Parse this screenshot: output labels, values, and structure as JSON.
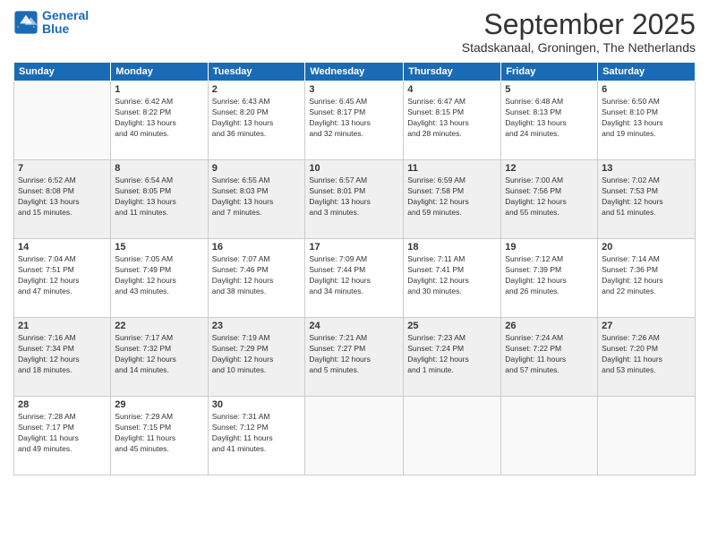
{
  "header": {
    "logo_line1": "General",
    "logo_line2": "Blue",
    "month": "September 2025",
    "location": "Stadskanaal, Groningen, The Netherlands"
  },
  "days_of_week": [
    "Sunday",
    "Monday",
    "Tuesday",
    "Wednesday",
    "Thursday",
    "Friday",
    "Saturday"
  ],
  "weeks": [
    [
      {
        "day": "",
        "info": ""
      },
      {
        "day": "1",
        "info": "Sunrise: 6:42 AM\nSunset: 8:22 PM\nDaylight: 13 hours\nand 40 minutes."
      },
      {
        "day": "2",
        "info": "Sunrise: 6:43 AM\nSunset: 8:20 PM\nDaylight: 13 hours\nand 36 minutes."
      },
      {
        "day": "3",
        "info": "Sunrise: 6:45 AM\nSunset: 8:17 PM\nDaylight: 13 hours\nand 32 minutes."
      },
      {
        "day": "4",
        "info": "Sunrise: 6:47 AM\nSunset: 8:15 PM\nDaylight: 13 hours\nand 28 minutes."
      },
      {
        "day": "5",
        "info": "Sunrise: 6:48 AM\nSunset: 8:13 PM\nDaylight: 13 hours\nand 24 minutes."
      },
      {
        "day": "6",
        "info": "Sunrise: 6:50 AM\nSunset: 8:10 PM\nDaylight: 13 hours\nand 19 minutes."
      }
    ],
    [
      {
        "day": "7",
        "info": "Sunrise: 6:52 AM\nSunset: 8:08 PM\nDaylight: 13 hours\nand 15 minutes."
      },
      {
        "day": "8",
        "info": "Sunrise: 6:54 AM\nSunset: 8:05 PM\nDaylight: 13 hours\nand 11 minutes."
      },
      {
        "day": "9",
        "info": "Sunrise: 6:55 AM\nSunset: 8:03 PM\nDaylight: 13 hours\nand 7 minutes."
      },
      {
        "day": "10",
        "info": "Sunrise: 6:57 AM\nSunset: 8:01 PM\nDaylight: 13 hours\nand 3 minutes."
      },
      {
        "day": "11",
        "info": "Sunrise: 6:59 AM\nSunset: 7:58 PM\nDaylight: 12 hours\nand 59 minutes."
      },
      {
        "day": "12",
        "info": "Sunrise: 7:00 AM\nSunset: 7:56 PM\nDaylight: 12 hours\nand 55 minutes."
      },
      {
        "day": "13",
        "info": "Sunrise: 7:02 AM\nSunset: 7:53 PM\nDaylight: 12 hours\nand 51 minutes."
      }
    ],
    [
      {
        "day": "14",
        "info": "Sunrise: 7:04 AM\nSunset: 7:51 PM\nDaylight: 12 hours\nand 47 minutes."
      },
      {
        "day": "15",
        "info": "Sunrise: 7:05 AM\nSunset: 7:49 PM\nDaylight: 12 hours\nand 43 minutes."
      },
      {
        "day": "16",
        "info": "Sunrise: 7:07 AM\nSunset: 7:46 PM\nDaylight: 12 hours\nand 38 minutes."
      },
      {
        "day": "17",
        "info": "Sunrise: 7:09 AM\nSunset: 7:44 PM\nDaylight: 12 hours\nand 34 minutes."
      },
      {
        "day": "18",
        "info": "Sunrise: 7:11 AM\nSunset: 7:41 PM\nDaylight: 12 hours\nand 30 minutes."
      },
      {
        "day": "19",
        "info": "Sunrise: 7:12 AM\nSunset: 7:39 PM\nDaylight: 12 hours\nand 26 minutes."
      },
      {
        "day": "20",
        "info": "Sunrise: 7:14 AM\nSunset: 7:36 PM\nDaylight: 12 hours\nand 22 minutes."
      }
    ],
    [
      {
        "day": "21",
        "info": "Sunrise: 7:16 AM\nSunset: 7:34 PM\nDaylight: 12 hours\nand 18 minutes."
      },
      {
        "day": "22",
        "info": "Sunrise: 7:17 AM\nSunset: 7:32 PM\nDaylight: 12 hours\nand 14 minutes."
      },
      {
        "day": "23",
        "info": "Sunrise: 7:19 AM\nSunset: 7:29 PM\nDaylight: 12 hours\nand 10 minutes."
      },
      {
        "day": "24",
        "info": "Sunrise: 7:21 AM\nSunset: 7:27 PM\nDaylight: 12 hours\nand 5 minutes."
      },
      {
        "day": "25",
        "info": "Sunrise: 7:23 AM\nSunset: 7:24 PM\nDaylight: 12 hours\nand 1 minute."
      },
      {
        "day": "26",
        "info": "Sunrise: 7:24 AM\nSunset: 7:22 PM\nDaylight: 11 hours\nand 57 minutes."
      },
      {
        "day": "27",
        "info": "Sunrise: 7:26 AM\nSunset: 7:20 PM\nDaylight: 11 hours\nand 53 minutes."
      }
    ],
    [
      {
        "day": "28",
        "info": "Sunrise: 7:28 AM\nSunset: 7:17 PM\nDaylight: 11 hours\nand 49 minutes."
      },
      {
        "day": "29",
        "info": "Sunrise: 7:29 AM\nSunset: 7:15 PM\nDaylight: 11 hours\nand 45 minutes."
      },
      {
        "day": "30",
        "info": "Sunrise: 7:31 AM\nSunset: 7:12 PM\nDaylight: 11 hours\nand 41 minutes."
      },
      {
        "day": "",
        "info": ""
      },
      {
        "day": "",
        "info": ""
      },
      {
        "day": "",
        "info": ""
      },
      {
        "day": "",
        "info": ""
      }
    ]
  ]
}
